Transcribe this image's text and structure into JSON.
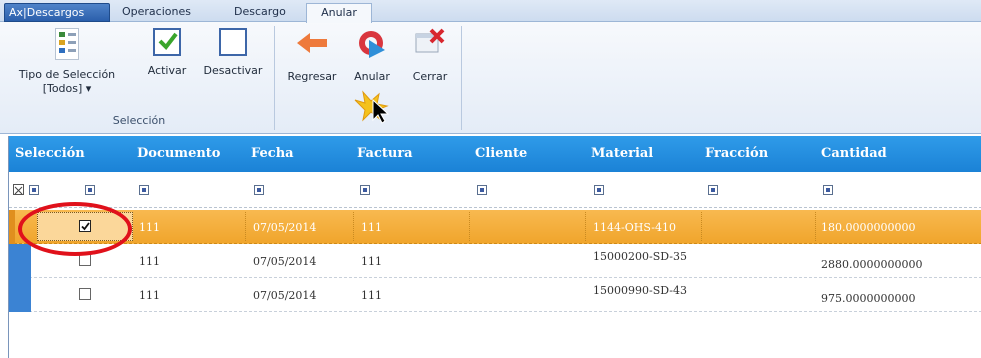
{
  "tabs": {
    "app": "Ax|Descargos",
    "operaciones": "Operaciones",
    "descargo": "Descargo",
    "anular": "Anular"
  },
  "ribbon": {
    "seleccion_group": {
      "label": "Selección",
      "tipo_line1": "Tipo de Selección",
      "tipo_line2": "[Todos] ▾",
      "activar": "Activar",
      "desactivar": "Desactivar"
    },
    "actions_group": {
      "regresar": "Regresar",
      "anular": "Anular",
      "cerrar": "Cerrar"
    }
  },
  "grid": {
    "columns": [
      "Selección",
      "Documento",
      "Fecha",
      "Factura",
      "Cliente",
      "Material",
      "Fracción",
      "Cantidad"
    ],
    "rows": [
      {
        "checked": true,
        "documento": "111",
        "fecha": "07/05/2014",
        "factura": "111",
        "cliente": "",
        "material": "1144-OHS-410",
        "fraccion": "",
        "cantidad": "180.0000000000"
      },
      {
        "checked": false,
        "documento": "111",
        "fecha": "07/05/2014",
        "factura": "111",
        "cliente": "",
        "material": "15000200-SD-35",
        "fraccion": "",
        "cantidad": "2880.0000000000"
      },
      {
        "checked": false,
        "documento": "111",
        "fecha": "07/05/2014",
        "factura": "111",
        "cliente": "",
        "material": "15000990-SD-43",
        "fraccion": "",
        "cantidad": "975.0000000000"
      }
    ]
  },
  "colors": {
    "header_blue": "#1b82d6",
    "selected_row": "#f0a52c",
    "highlight_ellipse": "#e0111b"
  }
}
